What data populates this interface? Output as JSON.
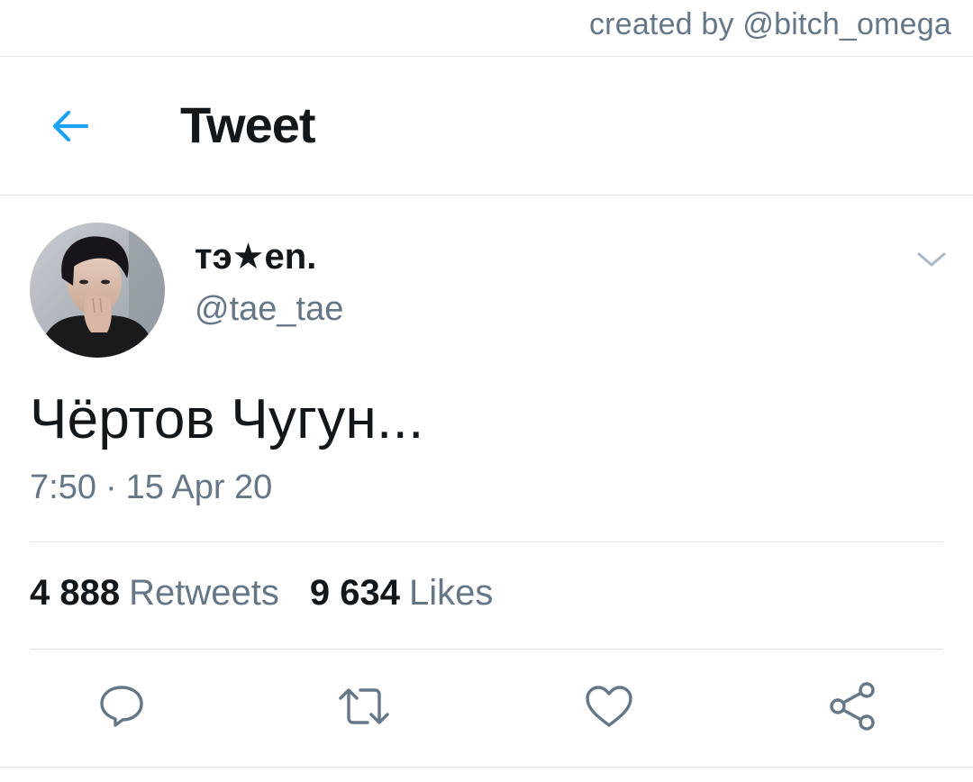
{
  "credit": "created by @bitch_omega",
  "header": {
    "title": "Tweet",
    "back_icon": "arrow-left-icon",
    "accent_color": "#1da1f2"
  },
  "tweet": {
    "display_name": "тэ★en.",
    "handle": "@tae_tae",
    "text": "Чёртов Чугун...",
    "time": "7:50",
    "separator": "·",
    "date": "15 Apr 20",
    "menu_icon": "chevron-down-icon"
  },
  "stats": {
    "retweets_count": "4 888",
    "retweets_label": "Retweets",
    "likes_count": "9 634",
    "likes_label": "Likes"
  },
  "actions": [
    {
      "name": "reply",
      "icon": "reply-icon"
    },
    {
      "name": "retweet",
      "icon": "retweet-icon"
    },
    {
      "name": "like",
      "icon": "heart-icon"
    },
    {
      "name": "share",
      "icon": "share-icon"
    }
  ],
  "colors": {
    "text_primary": "#14171a",
    "text_secondary": "#657786",
    "divider": "#dfe3e7"
  }
}
